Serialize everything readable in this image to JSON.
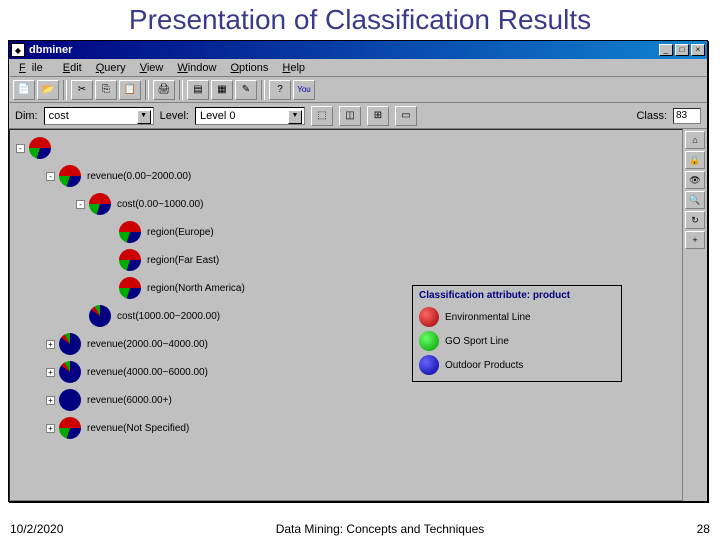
{
  "slide": {
    "title": "Presentation of Classification Results"
  },
  "app": {
    "title": "dbminer"
  },
  "menu": {
    "file": "File",
    "edit": "Edit",
    "query": "Query",
    "view": "View",
    "window": "Window",
    "options": "Options",
    "help": "Help"
  },
  "filter": {
    "dim_label": "Dim:",
    "dim_value": "cost",
    "level_label": "Level:",
    "level_value": "Level 0",
    "class_label": "Class:",
    "class_value": "83"
  },
  "tree": [
    {
      "indent": 0,
      "pie": "main",
      "label": "",
      "exp": "-"
    },
    {
      "indent": 1,
      "pie": "main",
      "label": "revenue(0.00~2000.00)",
      "exp": "-"
    },
    {
      "indent": 2,
      "pie": "main",
      "label": "cost(0.00~1000.00)",
      "exp": "-"
    },
    {
      "indent": 3,
      "pie": "main",
      "label": "region(Europe)",
      "exp": ""
    },
    {
      "indent": 3,
      "pie": "main",
      "label": "region(Far East)",
      "exp": ""
    },
    {
      "indent": 3,
      "pie": "main",
      "label": "region(North America)",
      "exp": ""
    },
    {
      "indent": 2,
      "pie": "blue",
      "label": "cost(1000.00~2000.00)",
      "exp": ""
    },
    {
      "indent": 1,
      "pie": "blue",
      "label": "revenue(2000.00~4000.00)",
      "exp": "+"
    },
    {
      "indent": 1,
      "pie": "blue",
      "label": "revenue(4000.00~6000.00)",
      "exp": "+"
    },
    {
      "indent": 1,
      "pie": "bluefull",
      "label": "revenue(6000.00+)",
      "exp": "+"
    },
    {
      "indent": 1,
      "pie": "main",
      "label": "revenue(Not Specified)",
      "exp": "+"
    }
  ],
  "legend": {
    "title": "Classification attribute: product",
    "items": [
      {
        "color": "red",
        "label": "Environmental Line"
      },
      {
        "color": "green",
        "label": "GO Sport Line"
      },
      {
        "color": "blue",
        "label": "Outdoor Products"
      }
    ]
  },
  "footer": {
    "date": "10/2/2020",
    "caption": "Data Mining: Concepts and Techniques",
    "page": "28"
  }
}
